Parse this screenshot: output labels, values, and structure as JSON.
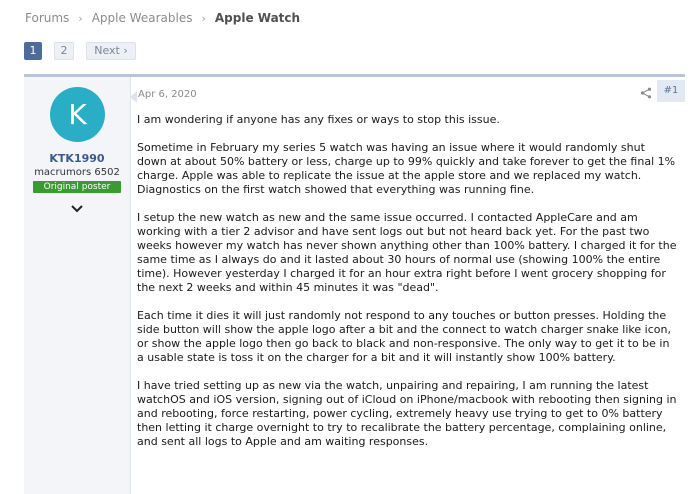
{
  "breadcrumb": {
    "items": [
      "Forums",
      "Apple Wearables"
    ],
    "current": "Apple Watch",
    "separator": "›"
  },
  "pagination": {
    "pages": [
      "1",
      "2"
    ],
    "current_page": "1",
    "next_label": "Next ›"
  },
  "post": {
    "date": "Apr 6, 2020",
    "number": "#1",
    "author": {
      "avatar_letter": "K",
      "username": "KTK1990",
      "title": "macrumors 6502",
      "badge": "Original poster"
    },
    "paragraphs": [
      "I am wondering if anyone has any fixes or ways to stop this issue.",
      "Sometime in February my series 5 watch was having an issue where it would randomly shut down at about 50% battery or less, charge up to 99% quickly and take forever to get the final 1% charge. Apple was able to replicate the issue at the apple store and we replaced my watch. Diagnostics on the first watch showed that everything was running fine.",
      "I setup the new watch as new and the same issue occurred. I contacted AppleCare and am working with a tier 2 advisor and have sent logs out but not heard back yet. For the past two weeks however my watch has never shown anything other than 100% battery. I charged it for the same time as I always do and it lasted about 30 hours of normal use (showing 100% the entire time). However yesterday I charged it for an hour extra right before I went grocery shopping for the next 2 weeks and within 45 minutes it was \"dead\".",
      "Each time it dies it will just randomly not respond to any touches or button presses. Holding the side button will show the apple logo after a bit and the connect to watch charger snake like icon, or show the apple logo then go back to black and non-responsive. The only way to get it to be in a usable state is toss it on the charger for a bit and it will instantly show 100% battery.",
      "I have tried setting up as new via the watch, unpairing and repairing, I am running the latest watchOS and iOS version, signing out of iCloud on iPhone/macbook with rebooting then signing in and rebooting, force restarting, power cycling, extremely heavy use trying to get to 0% battery then letting it charge overnight to try to recalibrate the battery percentage, complaining online, and sent all logs to Apple and am waiting responses."
    ]
  },
  "colors": {
    "accent": "#4d6c9b",
    "avatar": "#2aaec6",
    "badge": "#3a9b30"
  },
  "icons": [
    "share-icon",
    "chevron-down-icon"
  ]
}
